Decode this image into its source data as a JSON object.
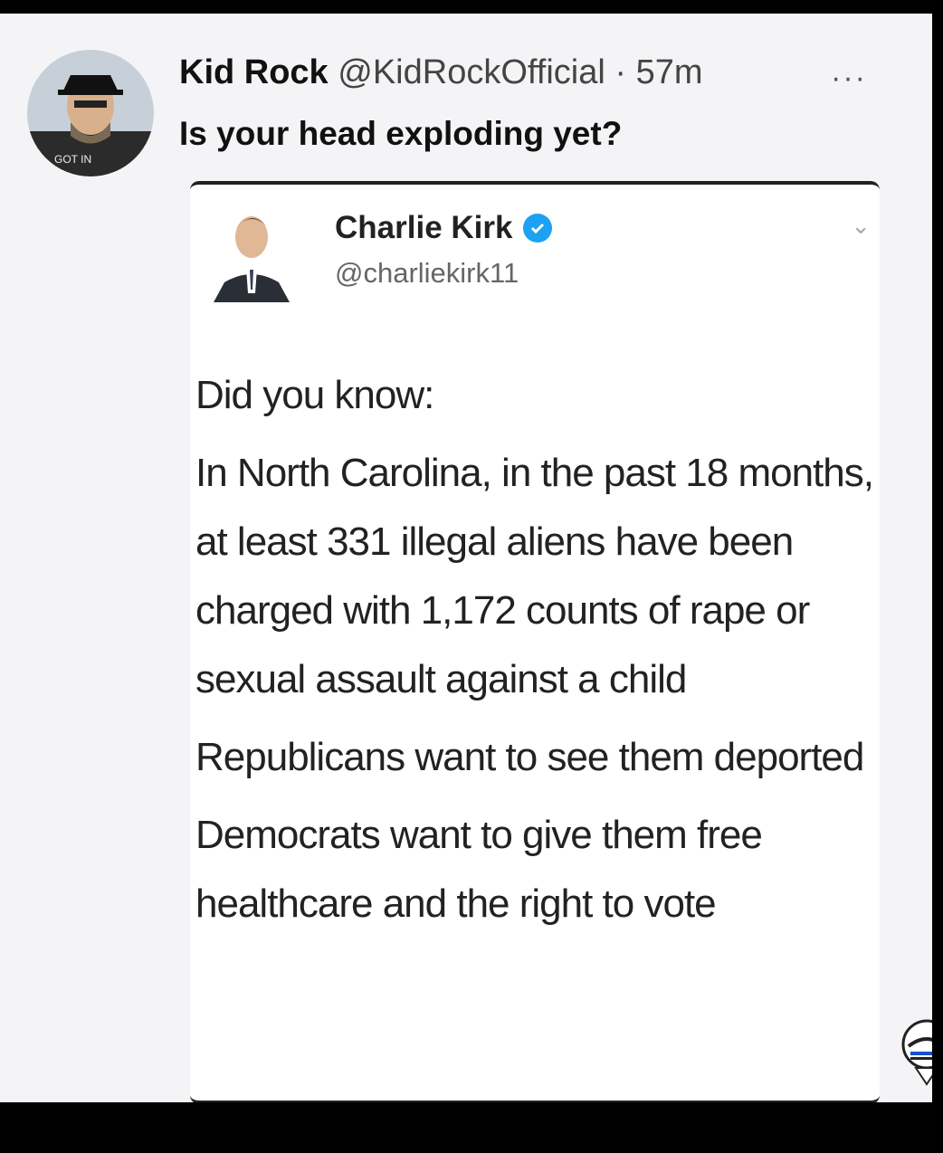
{
  "tweet": {
    "author_name": "Kid Rock",
    "author_handle": "@KidRockOfficial",
    "separator": "·",
    "time": "57m",
    "more_label": "···",
    "text": "Is your head exploding yet?"
  },
  "quoted_tweet": {
    "author_name": "Charlie Kirk",
    "author_handle": "@charliekirk11",
    "verified": true,
    "paragraphs": [
      "Did you know:",
      "In North Carolina, in the past 18 months, at least 331 illegal aliens have been charged with 1,172 counts of rape or sexual assault against a child",
      "Republicans want to see them deported",
      "Democrats want to give them free healthcare and the right to vote"
    ]
  },
  "colors": {
    "background": "#f4f4f6",
    "verified_badge": "#1da1f2",
    "frame": "#000000"
  },
  "icons": {
    "more": "more-horizontal-icon",
    "verified": "verified-badge-icon",
    "chevron": "chevron-down-icon"
  }
}
